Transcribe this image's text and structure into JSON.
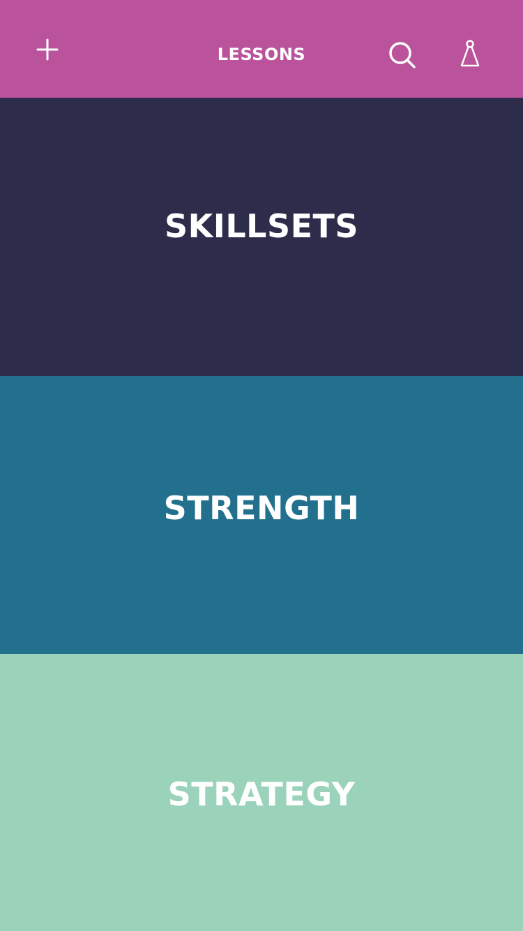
{
  "header": {
    "title": "LESSONS",
    "background_color": "#BA539C",
    "icons": {
      "add": "plus-icon",
      "search": "search-icon",
      "profile": "chess-pawn-icon"
    }
  },
  "tiles": [
    {
      "label": "SKILLSETS",
      "color": "#2D2C4B"
    },
    {
      "label": "STRENGTH",
      "color": "#22708D"
    },
    {
      "label": "STRATEGY",
      "color": "#9AD3BA"
    }
  ]
}
